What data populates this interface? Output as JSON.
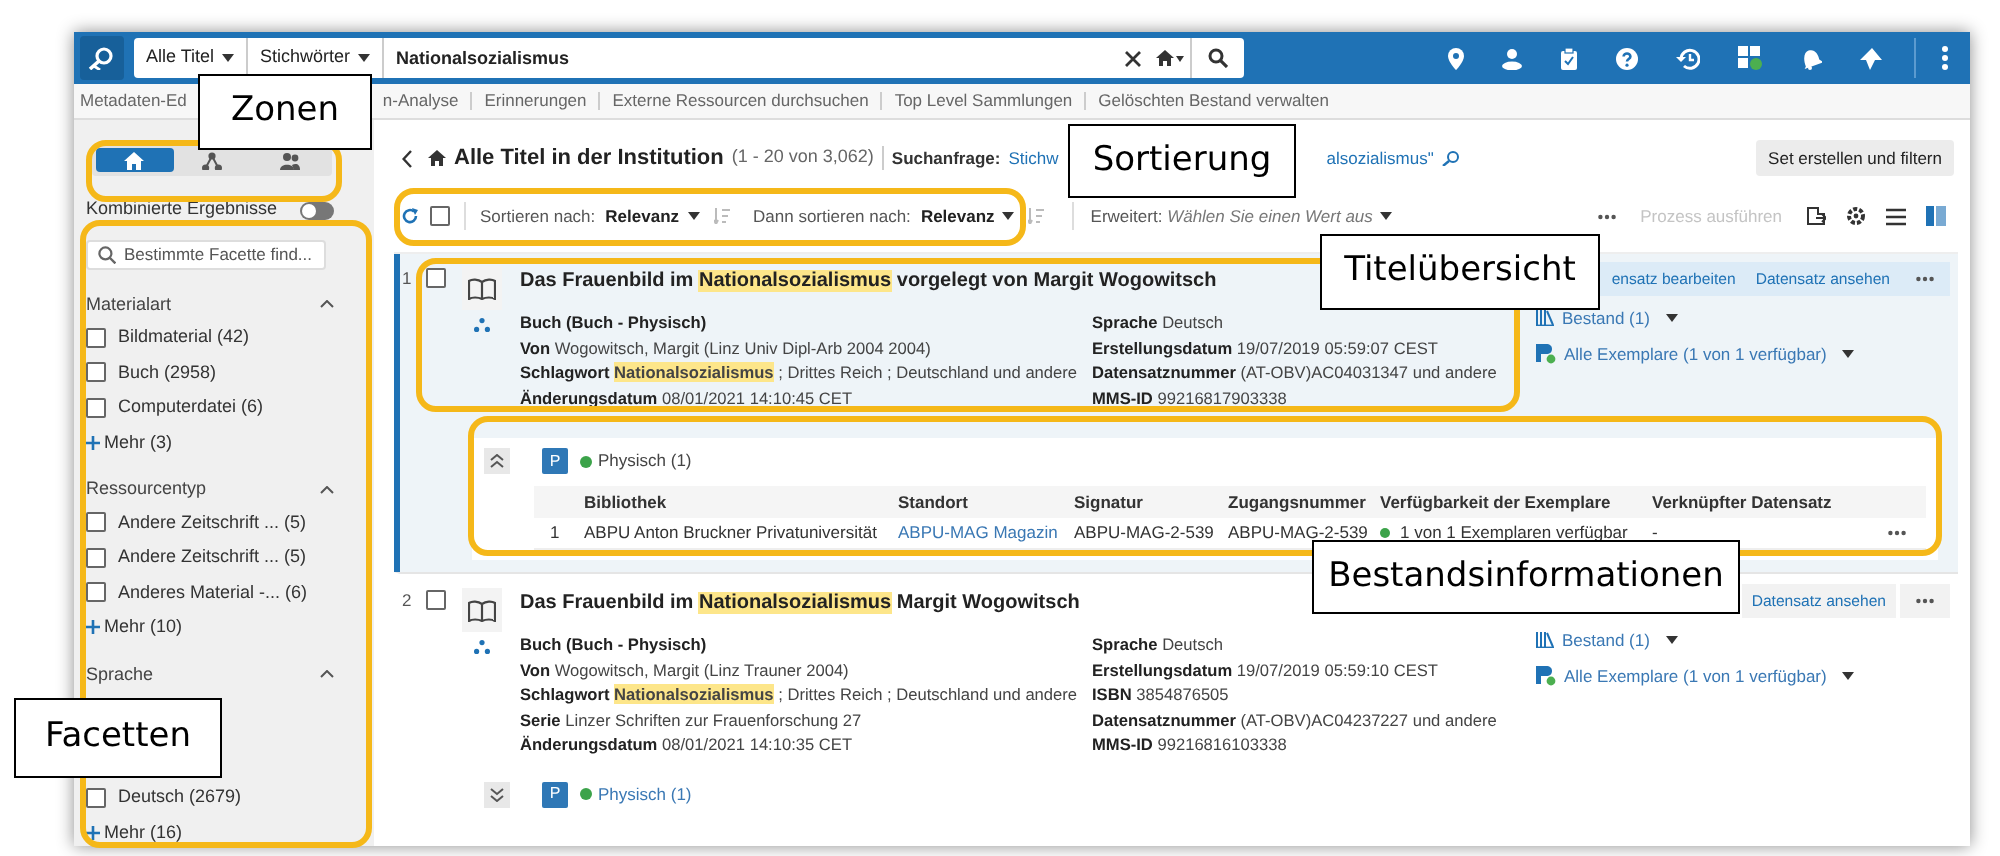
{
  "app_bar": {
    "search_scope": "Alle Titel",
    "search_type": "Stichwörter",
    "query": "Nationalsozialismus"
  },
  "nav_links": [
    "Metadaten-Ed",
    "n-Analyse",
    "Erinnerungen",
    "Externe Ressourcen durchsuchen",
    "Top Level Sammlungen",
    "Gelöschten Bestand verwalten"
  ],
  "zones": [
    {
      "kind": "home",
      "selected": true
    },
    {
      "kind": "network",
      "selected": false
    },
    {
      "kind": "people",
      "selected": false
    }
  ],
  "combined": {
    "label": "Kombinierte Ergebnisse",
    "on": false
  },
  "facet_search": {
    "placeholder": "Bestimmte Facette find..."
  },
  "facets": [
    {
      "title": "Materialart",
      "expanded": true,
      "items": [
        {
          "label": "Bildmaterial (42)",
          "checked": false
        },
        {
          "label": "Buch (2958)",
          "checked": false
        },
        {
          "label": "Computerdatei (6)",
          "checked": false
        }
      ],
      "more": "Mehr (3)"
    },
    {
      "title": "Ressourcentyp",
      "expanded": true,
      "items": [
        {
          "label": "Andere Zeitschrift ... (5)",
          "checked": false
        },
        {
          "label": "Andere Zeitschrift ... (5)",
          "checked": false
        },
        {
          "label": "Anderes Material -... (6)",
          "checked": false
        }
      ],
      "more": "Mehr (10)"
    },
    {
      "title": "Sprache",
      "expanded": true,
      "items": [
        {
          "label": "Deutsch (2679)",
          "checked": false
        }
      ],
      "more": "Mehr (16)"
    }
  ],
  "header": {
    "title": "Alle Titel in der Institution",
    "count": "(1 - 20 von 3,062)",
    "query_label": "Suchanfrage:",
    "query_parts": [
      "Stichw",
      "alsozialismus\""
    ],
    "button": "Set erstellen und filtern"
  },
  "toolbar": {
    "select_all_checked": false,
    "sort_label": "Sortieren nach:",
    "sort_value": "Relevanz",
    "then_label": "Dann sortieren nach:",
    "then_value": "Relevanz",
    "advanced": "Erweitert: *Wählen Sie einen Wert aus*",
    "process": {
      "label": "Prozess ausführen",
      "disabled": true
    }
  },
  "results": [
    {
      "number": "1",
      "selected": true,
      "checked": false,
      "title": "Das Frauenbild im **Nationalsozialismus** vorgelegt von Margit Wogowitsch",
      "format": "Buch (Buch - Physisch)",
      "left": [
        {
          "label": "Von",
          "value": "Wogowitsch, Margit (Linz Univ Dipl-Arb 2004 2004)"
        },
        {
          "label": "Schlagwort",
          "value": "**Nationalsozialismus** ; Drittes Reich ; Deutschland und andere"
        },
        {
          "label": "Änderungsdatum",
          "value": "08/01/2021 14:10:45 CET"
        }
      ],
      "right": [
        {
          "label": "Sprache",
          "value": "Deutsch"
        },
        {
          "label": "Erstellungsdatum",
          "value": "19/07/2019 05:59:07 CEST"
        },
        {
          "label": "Datensatznummer",
          "value": "(AT-OBV)AC04031347 und andere"
        },
        {
          "label": "MMS-ID",
          "value": "99216817903338"
        }
      ],
      "actions": [
        "ensatz bearbeiten",
        "Datensatz ansehen"
      ],
      "links": [
        "Bestand (1)",
        "Alle Exemplare (1 von 1 verfügbar)"
      ],
      "holdings": {
        "expanded": true,
        "badge": "P",
        "label": "Physisch (1)",
        "columns": [
          "Bibliothek",
          "Standort",
          "Signatur",
          "Zugangsnummer",
          "Verfügbarkeit der Exemplare",
          "Verknüpfter Datensatz"
        ],
        "rows": [
          {
            "number": "1",
            "cells": [
              "ABPU Anton Bruckner Privatuniversität",
              "ABPU-MAG Magazin",
              "ABPU-MAG-2-539",
              "ABPU-MAG-2-539",
              "1 von 1 Exemplaren verfügbar",
              "-"
            ]
          }
        ]
      }
    },
    {
      "number": "2",
      "selected": false,
      "checked": false,
      "title": "Das Frauenbild im **Nationalsozialismus** Margit Wogowitsch",
      "format": "Buch (Buch - Physisch)",
      "left": [
        {
          "label": "Von",
          "value": "Wogowitsch, Margit (Linz Trauner 2004)"
        },
        {
          "label": "Schlagwort",
          "value": "**Nationalsozialismus** ; Drittes Reich ; Deutschland und andere"
        },
        {
          "label": "Serie",
          "value": "Linzer Schriften zur Frauenforschung 27"
        },
        {
          "label": "Änderungsdatum",
          "value": "08/01/2021 14:10:35 CET"
        }
      ],
      "right": [
        {
          "label": "Sprache",
          "value": "Deutsch"
        },
        {
          "label": "Erstellungsdatum",
          "value": "19/07/2019 05:59:10 CEST"
        },
        {
          "label": "ISBN",
          "value": "3854876505"
        },
        {
          "label": "Datensatznummer",
          "value": "(AT-OBV)AC04237227 und andere"
        },
        {
          "label": "MMS-ID",
          "value": "99216816103338"
        }
      ],
      "actions": [
        "Datensatz ansehen"
      ],
      "links": [
        "Bestand (1)",
        "Alle Exemplare (1 von 1 verfügbar)"
      ],
      "holdings": {
        "expanded": false,
        "badge": "P",
        "label": "Physisch (1)"
      }
    }
  ],
  "annotations": [
    {
      "label": "Zonen"
    },
    {
      "label": "Sortierung"
    },
    {
      "label": "Titelübersicht"
    },
    {
      "label": "Bestandsinformationen"
    },
    {
      "label": "Facetten"
    }
  ]
}
